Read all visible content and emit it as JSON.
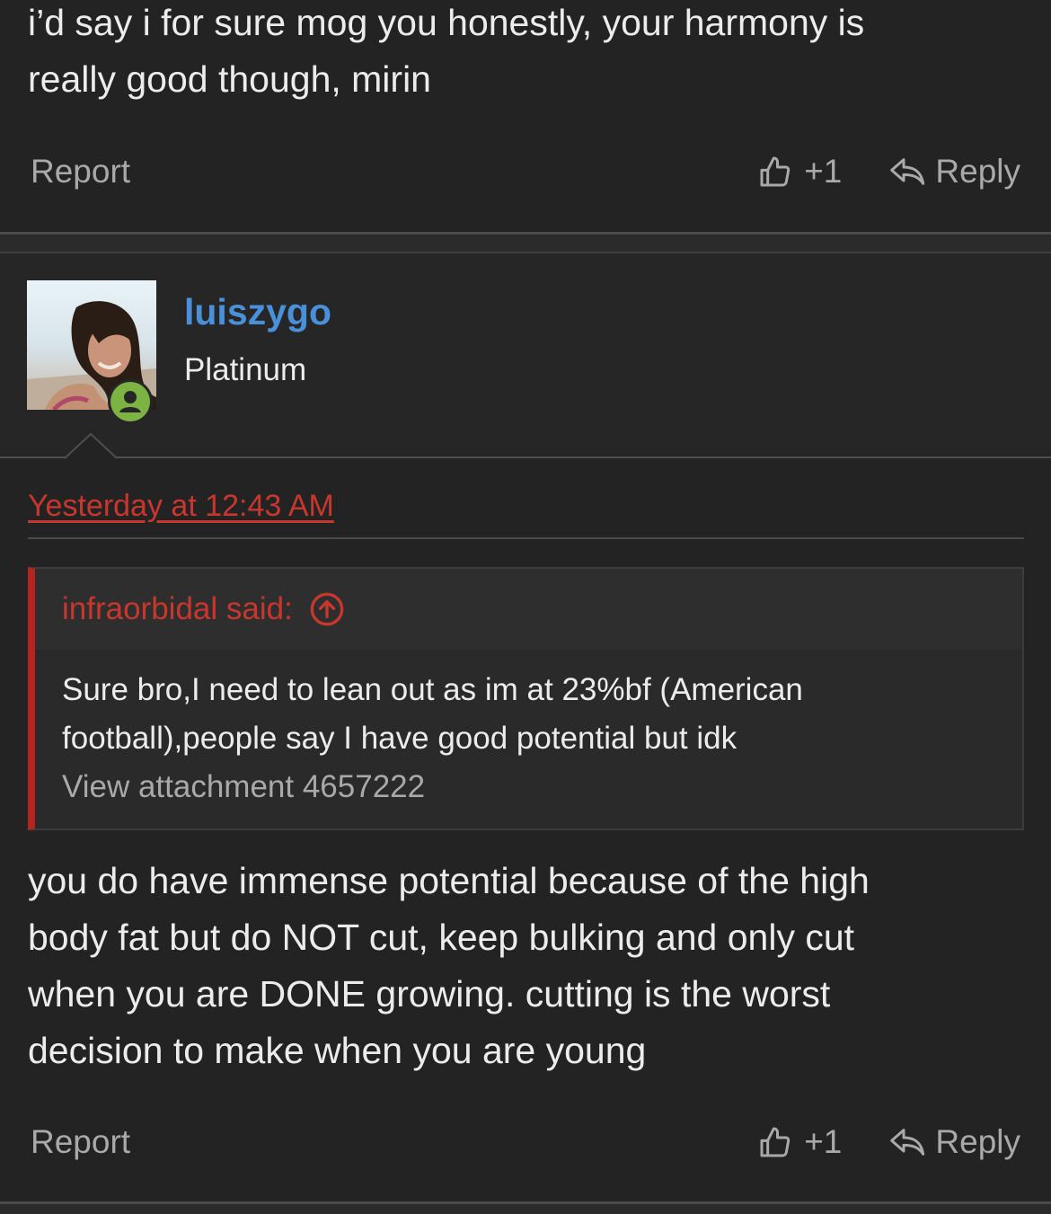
{
  "previous_post": {
    "body_line1": "i’d say i for sure mog you honestly, your harmony is",
    "body_line2": "really good though, mirin",
    "report_label": "Report",
    "like_count": "+1",
    "reply_label": "Reply"
  },
  "post": {
    "author": {
      "username": "luiszygo",
      "title": "Platinum",
      "status": "online",
      "status_color": "#7cb342"
    },
    "timestamp": "Yesterday at 12:43 AM",
    "quote": {
      "author_label": "infraorbidal said:",
      "line1": "Sure bro,I need to lean out as im at 23%bf (American",
      "line2": "football),people say I have good potential but idk",
      "attachment_label": "View attachment 4657222"
    },
    "body_lines": [
      "you do have immense potential because of the high",
      "body fat but do NOT cut, keep bulking and only cut",
      "when you are DONE growing. cutting is the worst",
      "decision to make when you are young"
    ],
    "report_label": "Report",
    "like_count": "+1",
    "reply_label": "Reply"
  },
  "colors": {
    "background": "#232323",
    "username": "#4a90d9",
    "accent_red": "#c8372d",
    "muted_text": "#a9a9a9"
  }
}
